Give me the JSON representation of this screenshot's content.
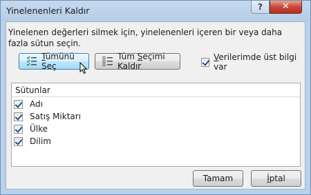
{
  "dialog": {
    "title": "Yinelenenleri Kaldır",
    "help_glyph": "?",
    "close_glyph": "✕"
  },
  "description": "Yinelenen değerleri silmek için, yinelenenleri içeren bir veya daha fazla sütun seçin.",
  "select_all": {
    "underline": "T",
    "rest": "ümünü Seç"
  },
  "unselect_all": {
    "pre": "Tüm ",
    "underline": "S",
    "rest": "eçimi Kaldır"
  },
  "headers_checkbox": {
    "underline": "V",
    "rest": "erilerimde üst bilgi var",
    "checked": true
  },
  "list": {
    "header": "Sütunlar",
    "columns": [
      {
        "label": "Adı",
        "checked": true
      },
      {
        "label": "Satış Miktarı",
        "checked": true
      },
      {
        "label": "Ülke",
        "checked": true
      },
      {
        "label": "Dilim",
        "checked": true
      }
    ]
  },
  "ok_button": "Tamam",
  "cancel_button": {
    "underline": "İ",
    "rest": "ptal"
  },
  "colors": {
    "accent": "#3c7fb1",
    "close_red": "#c9483a",
    "frame": "#b9d1ea"
  }
}
